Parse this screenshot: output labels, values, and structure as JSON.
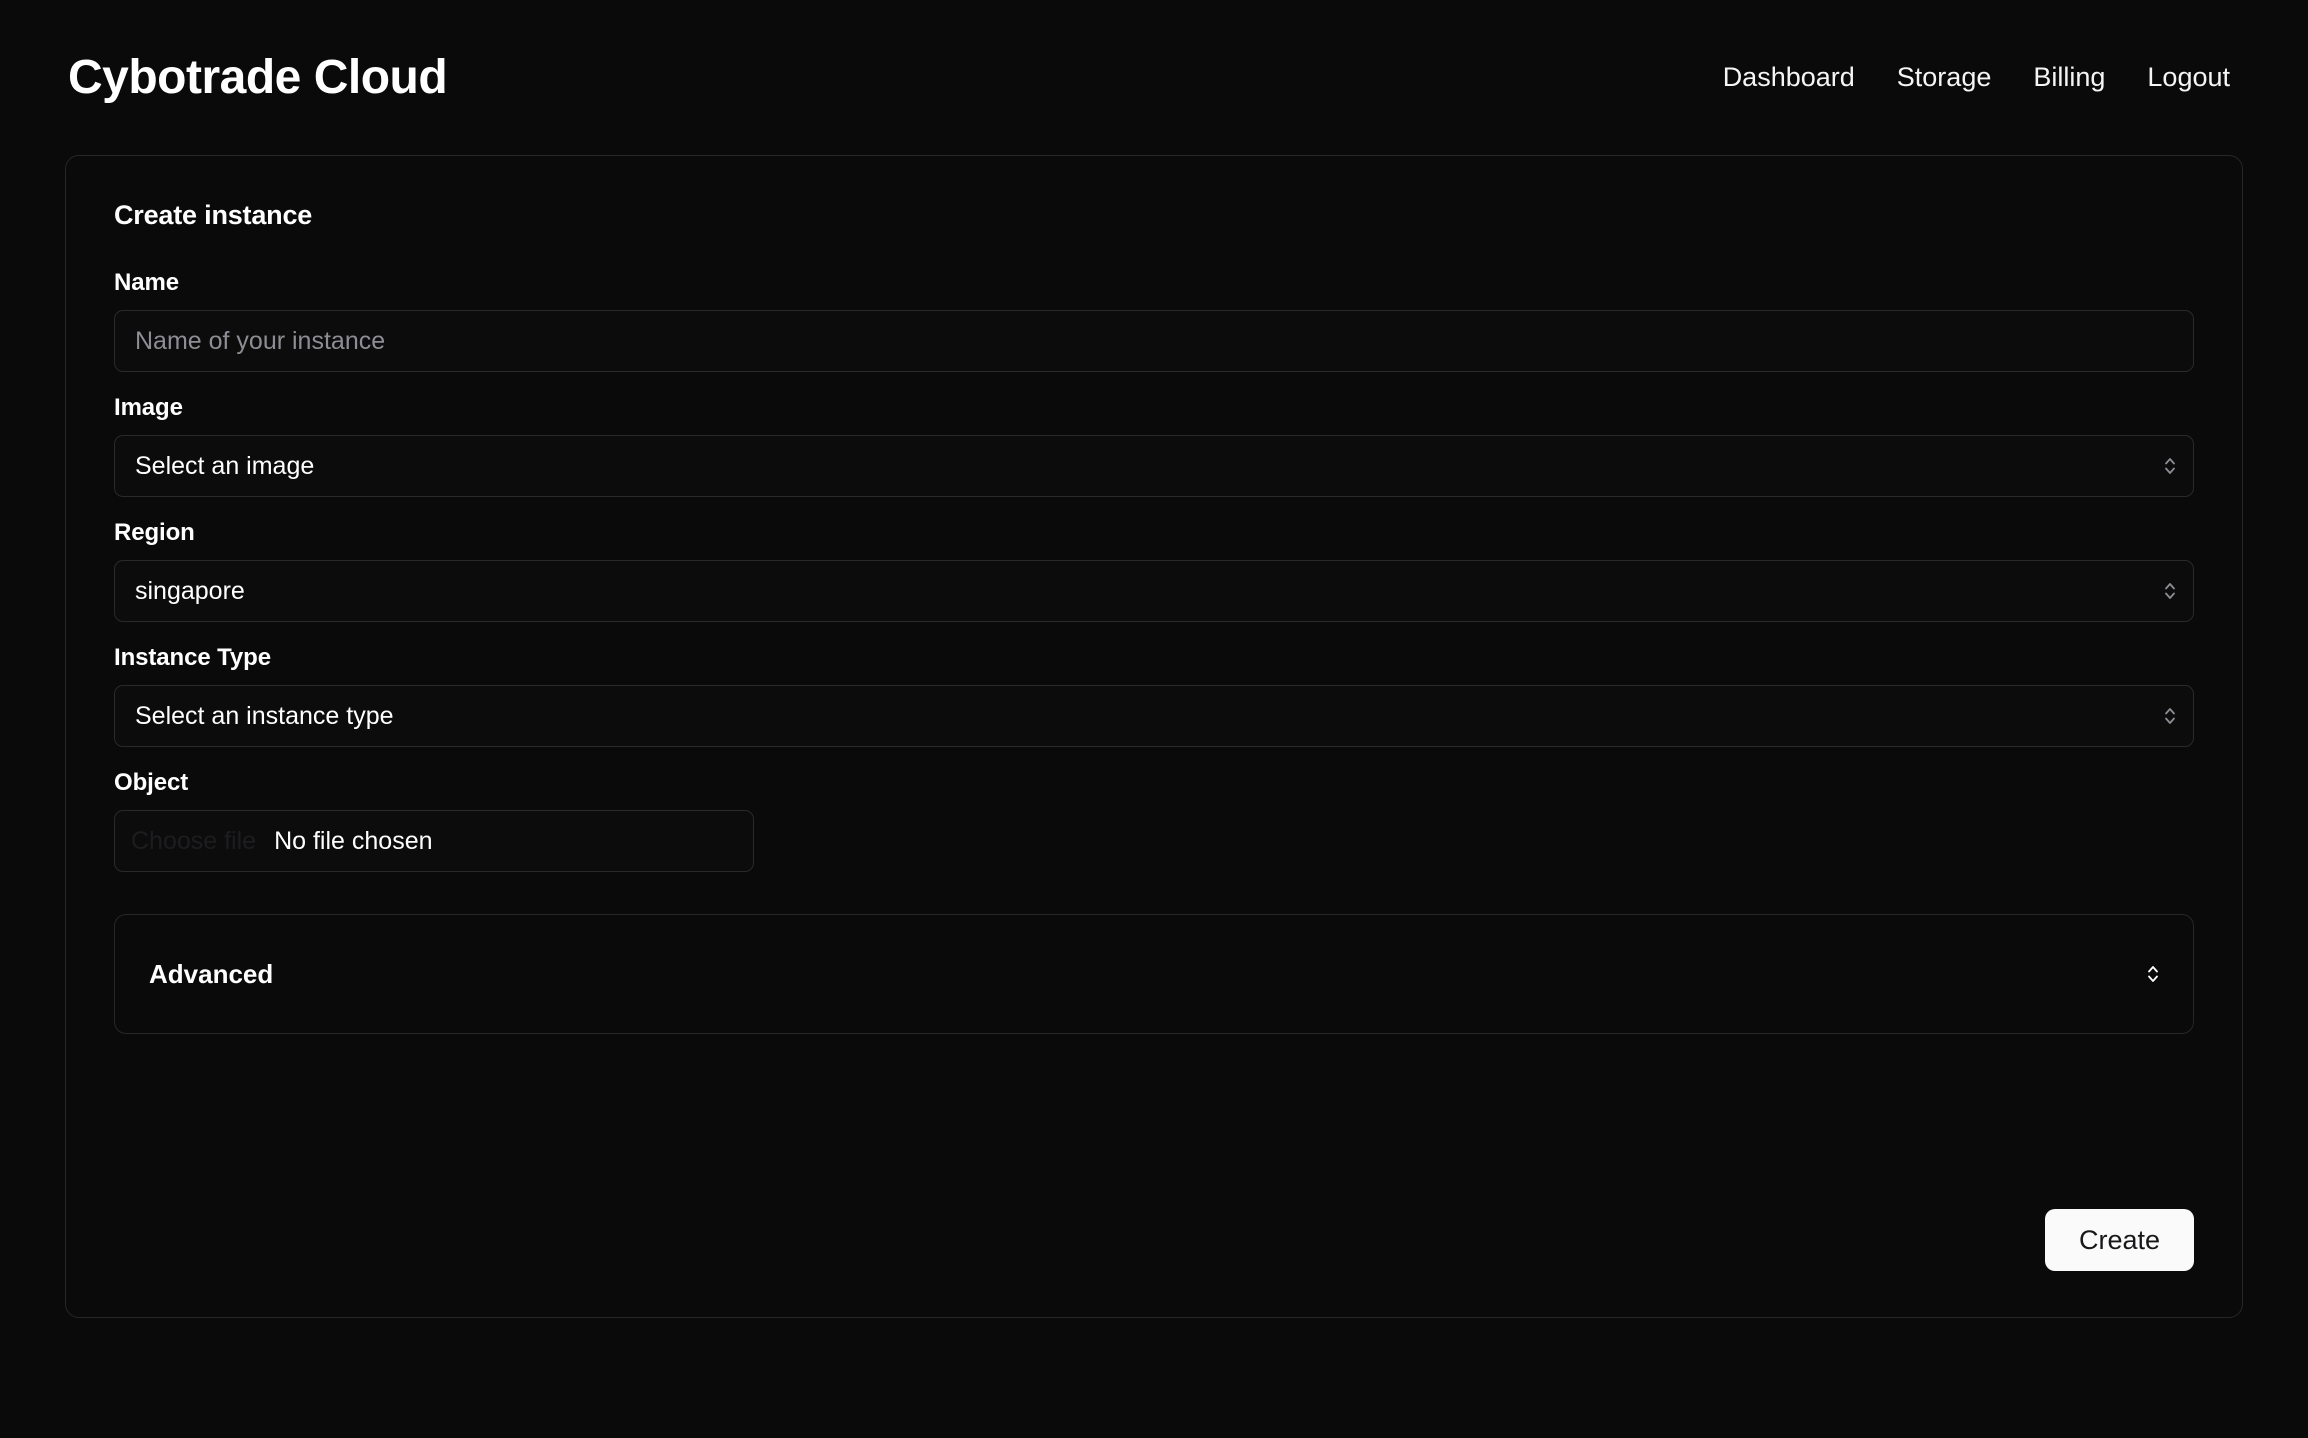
{
  "header": {
    "brand": "Cybotrade Cloud",
    "nav": [
      {
        "label": "Dashboard",
        "name": "nav-link-dashboard"
      },
      {
        "label": "Storage",
        "name": "nav-link-storage"
      },
      {
        "label": "Billing",
        "name": "nav-link-billing"
      },
      {
        "label": "Logout",
        "name": "nav-link-logout"
      }
    ]
  },
  "card": {
    "title": "Create instance",
    "fields": {
      "name": {
        "label": "Name",
        "value": "",
        "placeholder": "Name of your instance"
      },
      "image": {
        "label": "Image",
        "value": "Select an image"
      },
      "region": {
        "label": "Region",
        "value": "singapore"
      },
      "instance_type": {
        "label": "Instance Type",
        "value": "Select an instance type"
      },
      "object": {
        "label": "Object",
        "button_label": "Choose file",
        "status": "No file chosen"
      }
    },
    "advanced": {
      "label": "Advanced"
    },
    "submit_label": "Create"
  },
  "colors": {
    "page_background": "#0a0a0b",
    "card_border": "#27272a",
    "field_border": "#2a2a2e",
    "text_primary": "#ffffff",
    "text_placeholder": "#8d8d93",
    "accent_button": "#fafafa"
  },
  "icons": {
    "select_chevron": "chevron-up-down-icon",
    "advanced_chevron": "chevron-up-down-icon"
  }
}
